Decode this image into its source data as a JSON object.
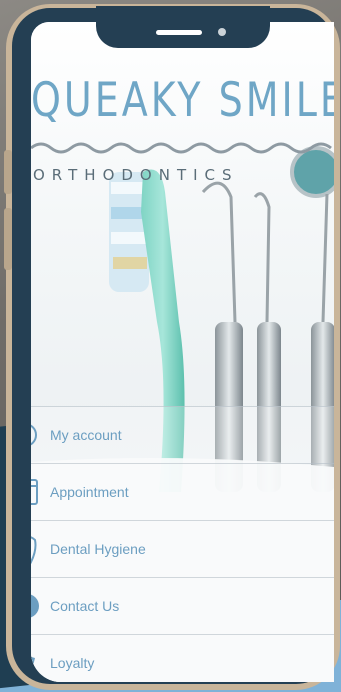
{
  "brand": {
    "title": "QUEAKY SMILES",
    "subtitle": "ORTHODONTICS",
    "accent_color": "#6fa6c6"
  },
  "menu": {
    "items": [
      {
        "label": "My account",
        "icon": "user-circle-icon"
      },
      {
        "label": "Appointment",
        "icon": "calendar-icon"
      },
      {
        "label": "Dental Hygiene",
        "icon": "tooth-icon"
      },
      {
        "label": "Contact Us",
        "icon": "phone-icon"
      },
      {
        "label": "Loyalty",
        "icon": "badge-icon"
      }
    ]
  }
}
